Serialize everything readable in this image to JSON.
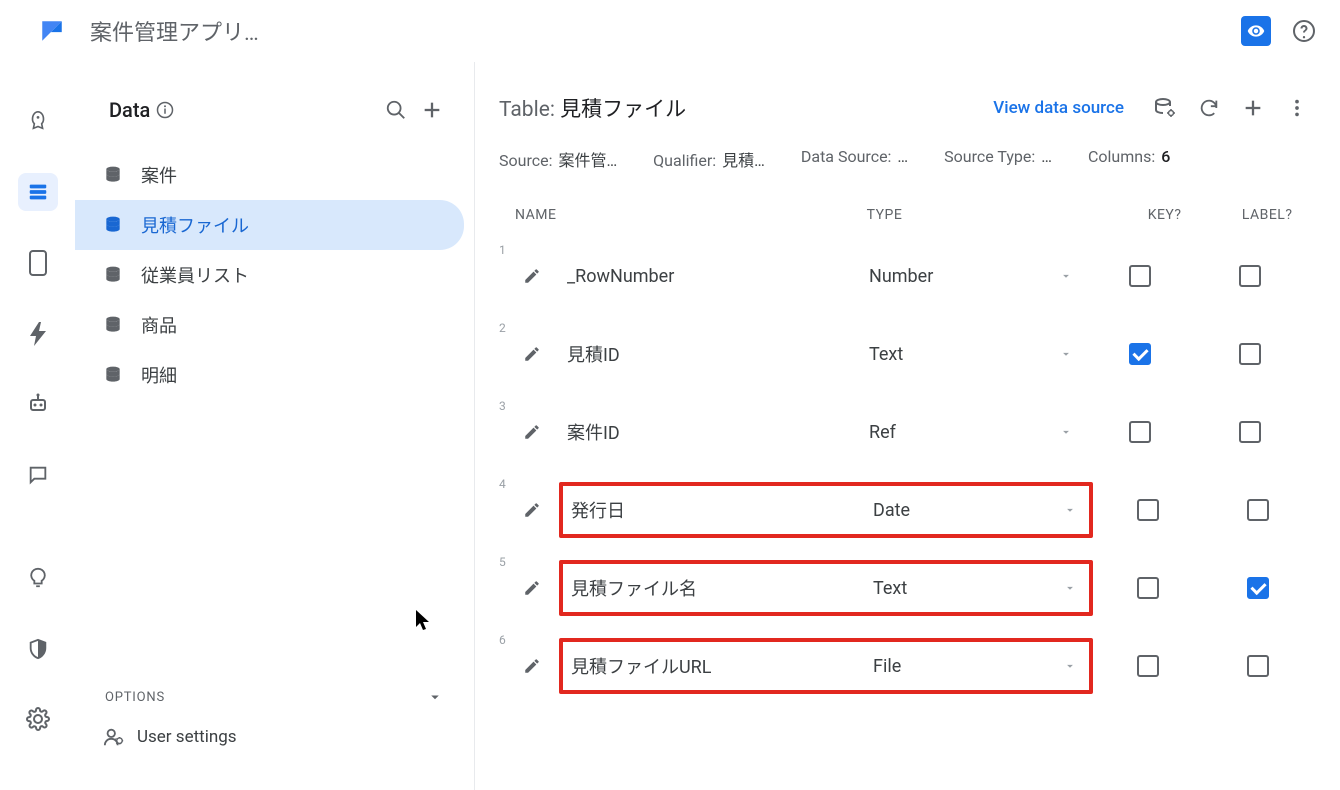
{
  "app_title": "案件管理アプリ…",
  "sidebar": {
    "title": "Data",
    "options_label": "OPTIONS",
    "user_settings_label": "User settings",
    "tables": [
      {
        "label": "案件",
        "active": false
      },
      {
        "label": "見積ファイル",
        "active": true
      },
      {
        "label": "従業員リスト",
        "active": false
      },
      {
        "label": "商品",
        "active": false
      },
      {
        "label": "明細",
        "active": false
      }
    ]
  },
  "content": {
    "table_label": "Table: ",
    "table_name": "見積ファイル",
    "view_source_label": "View data source",
    "meta": {
      "source_label": "Source:",
      "source_value": "案件管…",
      "qualifier_label": "Qualifier:",
      "qualifier_value": "見積…",
      "data_source_label": "Data Source:",
      "data_source_value": "…",
      "source_type_label": "Source Type:",
      "source_type_value": "…",
      "columns_label": "Columns:",
      "columns_value": "6"
    },
    "headers": {
      "name": "NAME",
      "type": "TYPE",
      "key": "KEY?",
      "label": "LABEL?"
    },
    "columns": [
      {
        "num": "1",
        "name": "_RowNumber",
        "type": "Number",
        "key": false,
        "label": false,
        "highlighted": false
      },
      {
        "num": "2",
        "name": "見積ID",
        "type": "Text",
        "key": true,
        "label": false,
        "highlighted": false
      },
      {
        "num": "3",
        "name": "案件ID",
        "type": "Ref",
        "key": false,
        "label": false,
        "highlighted": false
      },
      {
        "num": "4",
        "name": "発行日",
        "type": "Date",
        "key": false,
        "label": false,
        "highlighted": true
      },
      {
        "num": "5",
        "name": "見積ファイル名",
        "type": "Text",
        "key": false,
        "label": true,
        "highlighted": true
      },
      {
        "num": "6",
        "name": "見積ファイルURL",
        "type": "File",
        "key": false,
        "label": false,
        "highlighted": true
      }
    ]
  }
}
